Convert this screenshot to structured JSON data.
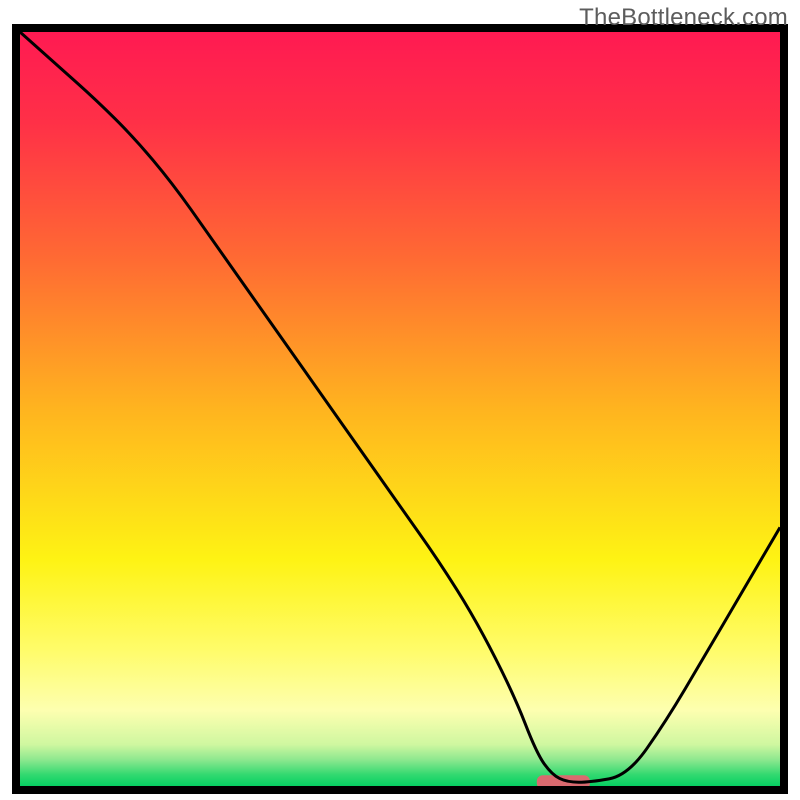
{
  "watermark": "TheBottleneck.com",
  "chart_data": {
    "type": "line",
    "title": "",
    "xlabel": "",
    "ylabel": "",
    "xlim": [
      0,
      100
    ],
    "ylim": [
      0,
      100
    ],
    "x": [
      0,
      5,
      10,
      15,
      20,
      25,
      30,
      35,
      40,
      45,
      50,
      55,
      60,
      65,
      68,
      70,
      72,
      75,
      80,
      85,
      90,
      95,
      100
    ],
    "values": [
      100,
      95.5,
      91,
      86,
      80,
      72.9,
      65.7,
      58.6,
      51.4,
      44.3,
      37.1,
      30,
      22,
      12.1,
      4.3,
      1.5,
      0.5,
      0.5,
      1.4,
      8.6,
      17.1,
      25.7,
      34.3
    ],
    "marker": {
      "x_start": 68,
      "x_end": 75,
      "y": 0.5
    },
    "gradient_stops": [
      {
        "offset": 0.0,
        "color": "#ff1a52"
      },
      {
        "offset": 0.12,
        "color": "#ff3047"
      },
      {
        "offset": 0.3,
        "color": "#ff6a33"
      },
      {
        "offset": 0.5,
        "color": "#ffb41f"
      },
      {
        "offset": 0.7,
        "color": "#fef314"
      },
      {
        "offset": 0.82,
        "color": "#fffc6a"
      },
      {
        "offset": 0.9,
        "color": "#fdffb0"
      },
      {
        "offset": 0.945,
        "color": "#cff7a0"
      },
      {
        "offset": 0.965,
        "color": "#8ee88f"
      },
      {
        "offset": 0.985,
        "color": "#32d970"
      },
      {
        "offset": 1.0,
        "color": "#06d062"
      }
    ]
  },
  "frame": {
    "stroke": "#000000",
    "stroke_width": 8
  },
  "curve": {
    "stroke": "#000000",
    "stroke_width": 3
  },
  "marker_style": {
    "fill": "#d96a6f",
    "rx": 6,
    "height": 14
  }
}
